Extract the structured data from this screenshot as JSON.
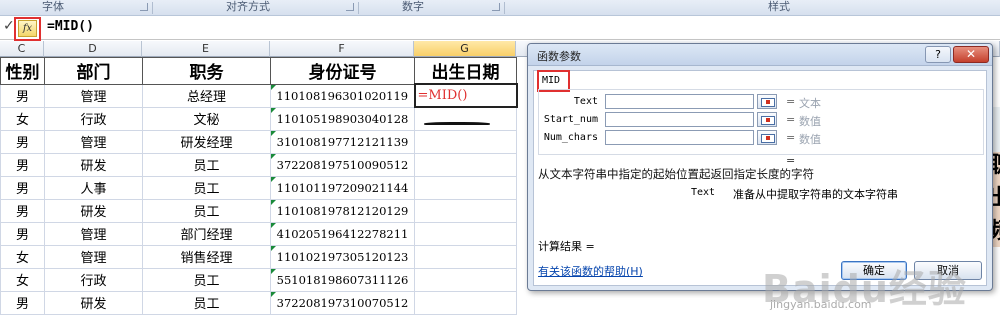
{
  "ribbon": {
    "groups": [
      "字体",
      "对齐方式",
      "数字",
      "样式"
    ]
  },
  "formula_bar": {
    "fx_label": "fx",
    "formula": "=MID()"
  },
  "columns": [
    "C",
    "D",
    "E",
    "F",
    "G"
  ],
  "active_column": "G",
  "table": {
    "headers": [
      "性别",
      "部门",
      "职务",
      "身份证号",
      "出生日期"
    ],
    "rows": [
      [
        "男",
        "管理",
        "总经理",
        "110108196301020119",
        "=MID()"
      ],
      [
        "女",
        "行政",
        "文秘",
        "110105198903040128",
        ""
      ],
      [
        "男",
        "管理",
        "研发经理",
        "310108197712121139",
        ""
      ],
      [
        "男",
        "研发",
        "员工",
        "372208197510090512",
        ""
      ],
      [
        "男",
        "人事",
        "员工",
        "110101197209021144",
        ""
      ],
      [
        "男",
        "研发",
        "员工",
        "110108197812120129",
        ""
      ],
      [
        "男",
        "管理",
        "部门经理",
        "410205196412278211",
        ""
      ],
      [
        "女",
        "管理",
        "销售经理",
        "110102197305120123",
        ""
      ],
      [
        "女",
        "行政",
        "员工",
        "551018198607311126",
        ""
      ],
      [
        "男",
        "研发",
        "员工",
        "372208197310070512",
        ""
      ]
    ]
  },
  "right_peek": [
    "职",
    "出",
    "频"
  ],
  "dialog": {
    "title": "函数参数",
    "help_symbol": "?",
    "close_symbol": "✕",
    "function_name": "MID",
    "args": [
      {
        "label": "Text",
        "value": "",
        "type": "文本"
      },
      {
        "label": "Start_num",
        "value": "",
        "type": "数值"
      },
      {
        "label": "Num_chars",
        "value": "",
        "type": "数值"
      }
    ],
    "equals": "=",
    "description": "从文本字符串中指定的起始位置起返回指定长度的字符",
    "arg_desc_name": "Text",
    "arg_desc_text": "准备从中提取字符串的文本字符串",
    "calc_result_label": "计算结果 =",
    "help_link": "有关该函数的帮助(H)",
    "ok_label": "确定",
    "cancel_label": "取消"
  },
  "watermark": {
    "brand": "Baidu经验",
    "url": "jingyan.baidu.com"
  }
}
